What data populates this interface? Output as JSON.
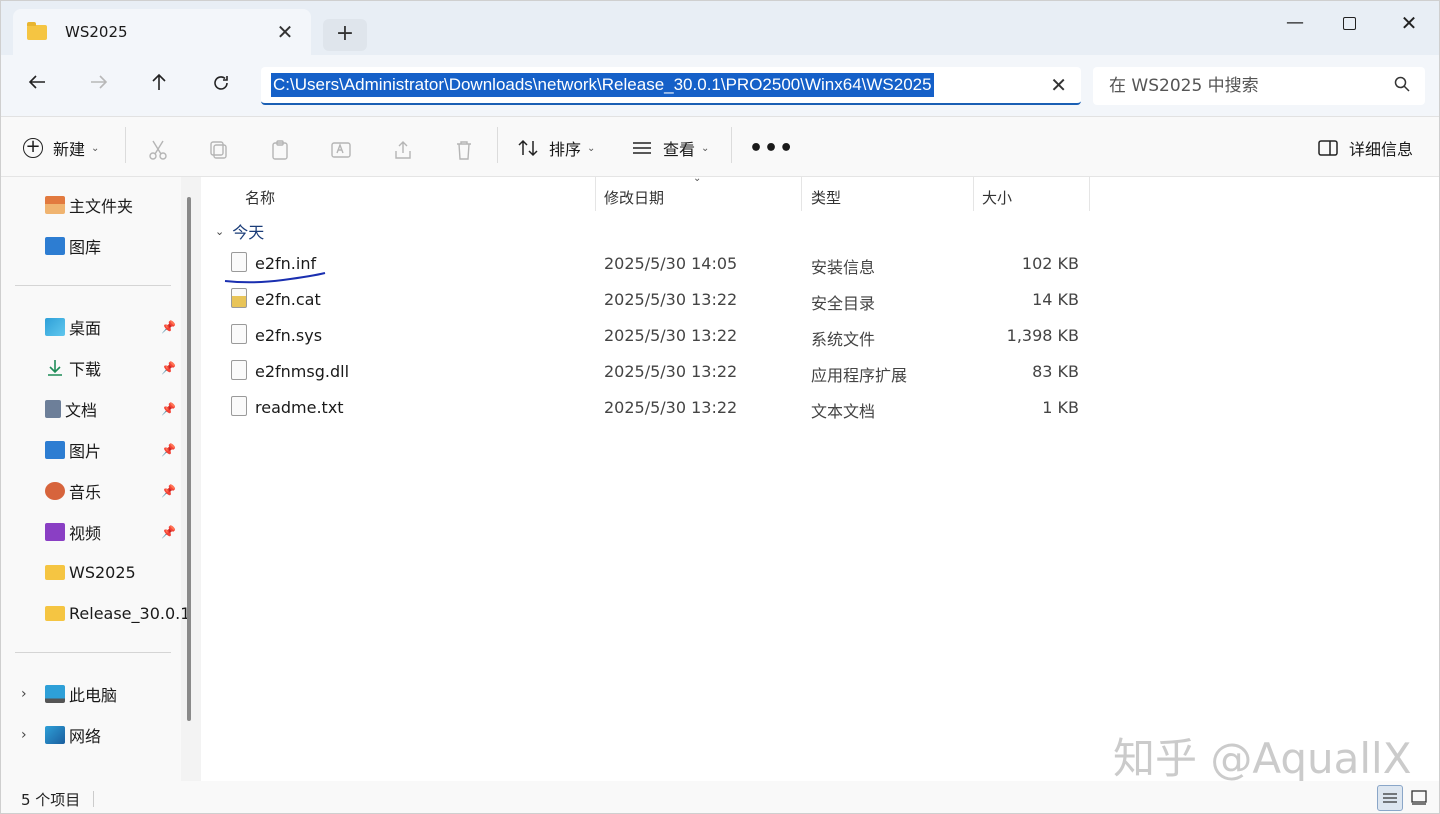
{
  "window": {
    "tab_title": "WS2025",
    "new_tab_symbol": "+",
    "minimize_symbol": "—",
    "close_symbol": "✕"
  },
  "address": {
    "path": "C:\\Users\\Administrator\\Downloads\\network\\Release_30.0.1\\PRO2500\\Winx64\\WS2025",
    "clear_symbol": "✕"
  },
  "search": {
    "placeholder": "在 WS2025 中搜索"
  },
  "toolbar": {
    "new_label": "新建",
    "sort_label": "排序",
    "view_label": "查看",
    "more_label": "•••",
    "details_label": "详细信息"
  },
  "sidebar": {
    "items": [
      {
        "label": "主文件夹",
        "icon": "home-icon",
        "pinned": false
      },
      {
        "label": "图库",
        "icon": "gallery-icon",
        "pinned": false
      },
      {
        "label": "桌面",
        "icon": "desktop-icon",
        "pinned": true
      },
      {
        "label": "下载",
        "icon": "download-icon",
        "pinned": true
      },
      {
        "label": "文档",
        "icon": "document-icon",
        "pinned": true
      },
      {
        "label": "图片",
        "icon": "pictures-icon",
        "pinned": true
      },
      {
        "label": "音乐",
        "icon": "music-icon",
        "pinned": true
      },
      {
        "label": "视频",
        "icon": "video-icon",
        "pinned": true
      },
      {
        "label": "WS2025",
        "icon": "folder-icon",
        "pinned": false
      },
      {
        "label": "Release_30.0.1",
        "icon": "folder-icon",
        "pinned": false
      },
      {
        "label": "此电脑",
        "icon": "computer-icon",
        "pinned": false
      },
      {
        "label": "网络",
        "icon": "network-icon",
        "pinned": false
      }
    ]
  },
  "columns": {
    "name": "名称",
    "date": "修改日期",
    "type": "类型",
    "size": "大小"
  },
  "group": {
    "label": "今天"
  },
  "files": [
    {
      "name": "e2fn.inf",
      "date": "2025/5/30 14:05",
      "type": "安装信息",
      "size": "102 KB",
      "icon": "inf-file-icon"
    },
    {
      "name": "e2fn.cat",
      "date": "2025/5/30 13:22",
      "type": "安全目录",
      "size": "14 KB",
      "icon": "cat-file-icon"
    },
    {
      "name": "e2fn.sys",
      "date": "2025/5/30 13:22",
      "type": "系统文件",
      "size": "1,398 KB",
      "icon": "sys-file-icon"
    },
    {
      "name": "e2fnmsg.dll",
      "date": "2025/5/30 13:22",
      "type": "应用程序扩展",
      "size": "83 KB",
      "icon": "dll-file-icon"
    },
    {
      "name": "readme.txt",
      "date": "2025/5/30 13:22",
      "type": "文本文档",
      "size": "1 KB",
      "icon": "txt-file-icon"
    }
  ],
  "status": {
    "item_count": "5 个项目"
  },
  "watermark": {
    "text": "知乎 @AquallX"
  },
  "colors": {
    "accent": "#1560c8",
    "folder": "#f5c542",
    "annotation": "#1a2fb0"
  }
}
